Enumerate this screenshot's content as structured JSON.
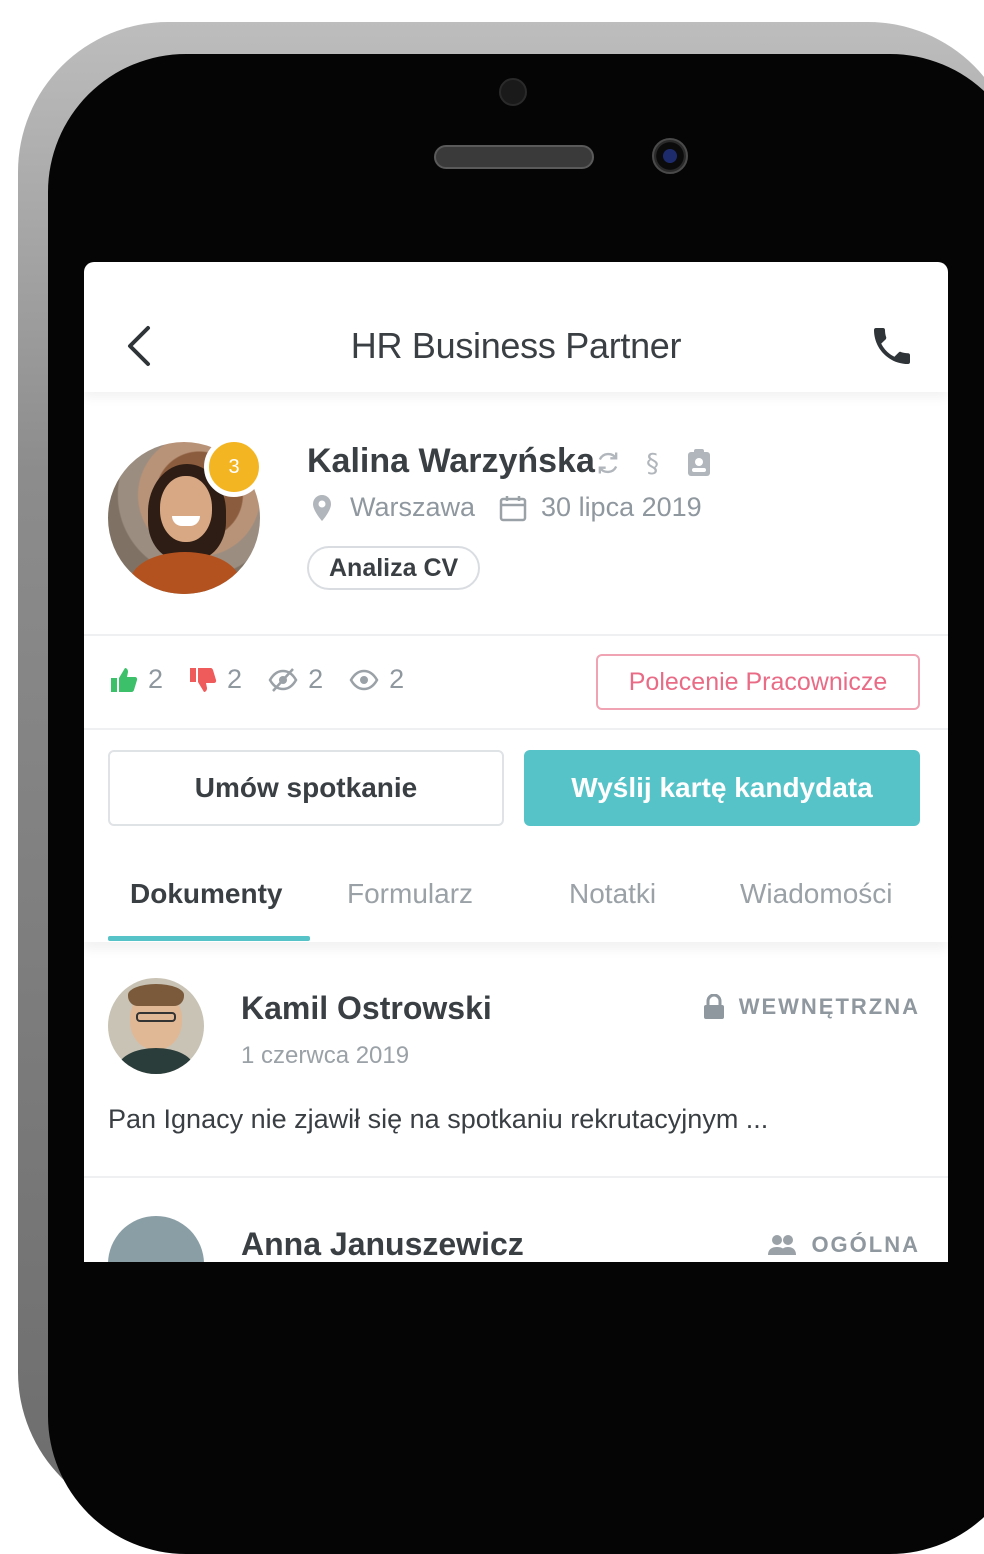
{
  "header": {
    "title": "HR Business Partner",
    "back_icon": "chevron-left-icon",
    "call_icon": "phone-icon"
  },
  "candidate": {
    "name": "Kalina Warzyńska",
    "badge_count": "3",
    "location": "Warszawa",
    "date": "30 lipca 2019",
    "status": "Analiza CV",
    "name_icons": [
      "refresh-icon",
      "paragraph-icon",
      "clipboard-icon"
    ]
  },
  "reactions": {
    "likes": "2",
    "dislikes": "2",
    "hidden": "2",
    "views": "2",
    "referral_label": "Polecenie Pracownicze"
  },
  "actions": {
    "schedule_label": "Umów spotkanie",
    "send_label": "Wyślij kartę kandydata"
  },
  "tabs": [
    {
      "label": "Dokumenty",
      "active": true
    },
    {
      "label": "Formularz",
      "active": false
    },
    {
      "label": "Notatki",
      "active": false
    },
    {
      "label": "Wiadomości",
      "active": false
    }
  ],
  "notes": [
    {
      "author": "Kamil Ostrowski",
      "date": "1 czerwca 2019",
      "visibility": "WEWNĘTRZNA",
      "visibility_icon": "lock-icon",
      "text": "Pan Ignacy nie zjawił się na spotkaniu rekrutacyjnym ..."
    },
    {
      "author": "Anna Januszewicz",
      "visibility": "OGÓLNA",
      "visibility_icon": "group-icon"
    }
  ],
  "colors": {
    "accent": "#56c3c8",
    "badge": "#f4b523",
    "like": "#3cc06a",
    "dislike": "#ef5a5a",
    "referral": "#e96b86",
    "text": "#3a3f44",
    "muted": "#8f979f"
  }
}
